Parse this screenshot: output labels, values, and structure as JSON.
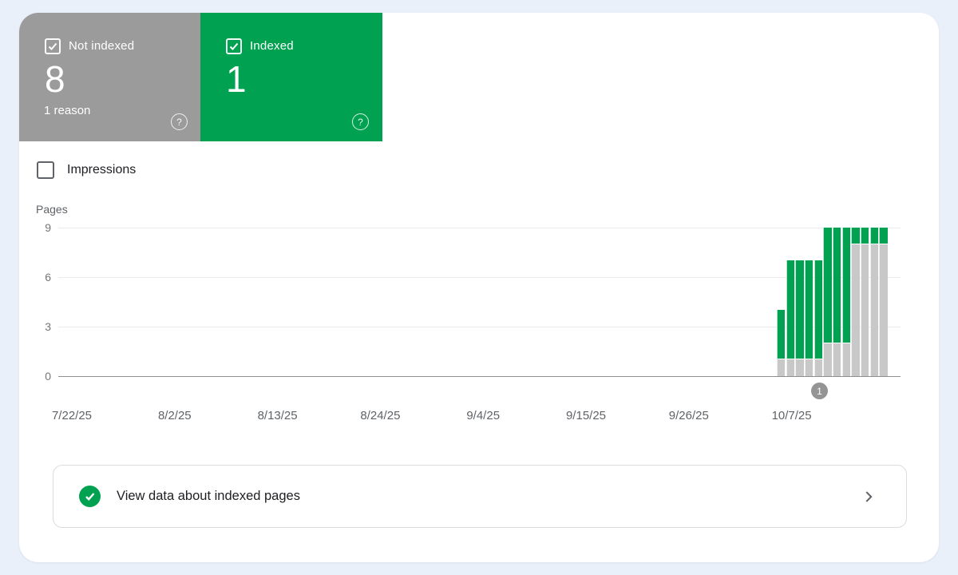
{
  "colors": {
    "green": "#00a150",
    "card_gray": "#9b9b9b",
    "bar_gray": "#c8c8c8",
    "background": "#e9f0f9"
  },
  "cards": {
    "not_indexed": {
      "label": "Not indexed",
      "value": "8",
      "sublabel": "1 reason",
      "checked": true
    },
    "indexed": {
      "label": "Indexed",
      "value": "1",
      "checked": true
    }
  },
  "impressions_toggle": {
    "label": "Impressions",
    "checked": false
  },
  "chart_data": {
    "type": "bar",
    "stacked": true,
    "ylabel_unit": "Pages",
    "ylim": [
      0,
      9
    ],
    "yticks": [
      9,
      6,
      3,
      0
    ],
    "xticks": [
      "7/22/25",
      "8/2/25",
      "8/13/25",
      "8/24/25",
      "9/4/25",
      "9/15/25",
      "9/26/25",
      "10/7/25"
    ],
    "grid": true,
    "legend_position": "none",
    "series": [
      {
        "name": "Not indexed",
        "color": "#c8c8c8",
        "values": [
          1,
          1,
          1,
          1,
          1,
          2,
          2,
          2,
          8,
          8,
          8,
          8
        ]
      },
      {
        "name": "Indexed",
        "color": "#00a150",
        "values": [
          3,
          6,
          6,
          6,
          6,
          7,
          7,
          7,
          1,
          1,
          1,
          1
        ]
      }
    ],
    "marker": {
      "label": "1"
    }
  },
  "footer_card": {
    "label": "View data about indexed pages"
  }
}
